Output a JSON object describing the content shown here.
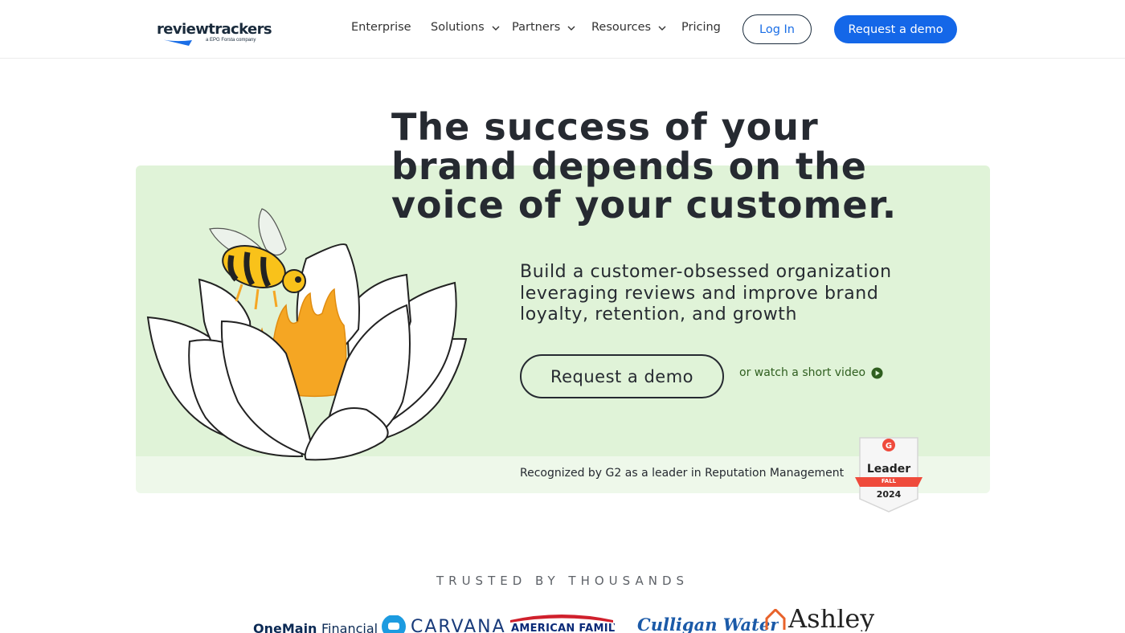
{
  "header": {
    "logo_text": "reviewtrackers",
    "logo_subtext": "a EPG Forsta company",
    "nav": [
      {
        "label": "Enterprise",
        "has_dropdown": false
      },
      {
        "label": "Solutions",
        "has_dropdown": true
      },
      {
        "label": "Partners",
        "has_dropdown": true
      },
      {
        "label": "Resources",
        "has_dropdown": true
      },
      {
        "label": "Pricing",
        "has_dropdown": false
      }
    ],
    "login_label": "Log In",
    "demo_label": "Request a demo"
  },
  "hero": {
    "title": "The success of your brand depends on the voice of your customer.",
    "subtitle": "Build a customer-obsessed organization leveraging reviews and improve brand loyalty, retention, and growth",
    "demo_button": "Request a demo",
    "video_link": "or watch a short video",
    "g2_text": "Recognized by G2 as a leader in Reputation Management",
    "badge": {
      "leader": "Leader",
      "season": "FALL",
      "year": "2024"
    }
  },
  "trusted": {
    "heading": "TRUSTED BY THOUSANDS",
    "brands": {
      "onemain": "OneMain",
      "onemain_suffix": "Financial",
      "carvana": "CARVANA",
      "amfam": "AMERICAN FAMILY",
      "culligan": "Culligan Water",
      "ashley": "Ashley"
    }
  },
  "colors": {
    "primary_blue": "#1467e8",
    "hero_green": "#e0f3d8",
    "text_dark": "#262a31",
    "link_green": "#2f5e1f"
  }
}
